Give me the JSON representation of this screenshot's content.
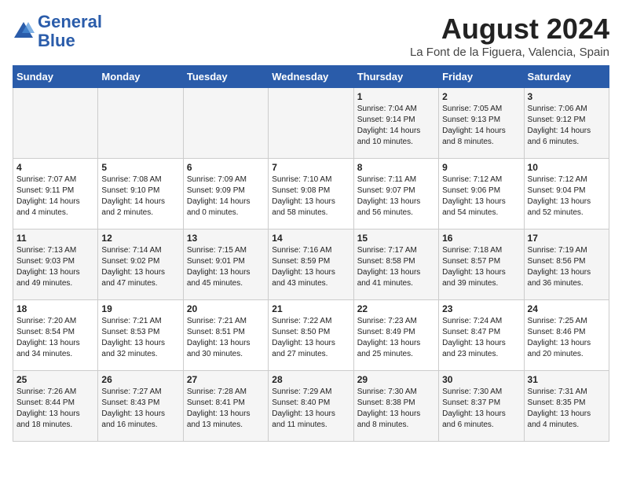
{
  "header": {
    "logo_line1": "General",
    "logo_line2": "Blue",
    "title": "August 2024",
    "subtitle": "La Font de la Figuera, Valencia, Spain"
  },
  "weekdays": [
    "Sunday",
    "Monday",
    "Tuesday",
    "Wednesday",
    "Thursday",
    "Friday",
    "Saturday"
  ],
  "weeks": [
    [
      {
        "day": "",
        "info": ""
      },
      {
        "day": "",
        "info": ""
      },
      {
        "day": "",
        "info": ""
      },
      {
        "day": "",
        "info": ""
      },
      {
        "day": "1",
        "info": "Sunrise: 7:04 AM\nSunset: 9:14 PM\nDaylight: 14 hours\nand 10 minutes."
      },
      {
        "day": "2",
        "info": "Sunrise: 7:05 AM\nSunset: 9:13 PM\nDaylight: 14 hours\nand 8 minutes."
      },
      {
        "day": "3",
        "info": "Sunrise: 7:06 AM\nSunset: 9:12 PM\nDaylight: 14 hours\nand 6 minutes."
      }
    ],
    [
      {
        "day": "4",
        "info": "Sunrise: 7:07 AM\nSunset: 9:11 PM\nDaylight: 14 hours\nand 4 minutes."
      },
      {
        "day": "5",
        "info": "Sunrise: 7:08 AM\nSunset: 9:10 PM\nDaylight: 14 hours\nand 2 minutes."
      },
      {
        "day": "6",
        "info": "Sunrise: 7:09 AM\nSunset: 9:09 PM\nDaylight: 14 hours\nand 0 minutes."
      },
      {
        "day": "7",
        "info": "Sunrise: 7:10 AM\nSunset: 9:08 PM\nDaylight: 13 hours\nand 58 minutes."
      },
      {
        "day": "8",
        "info": "Sunrise: 7:11 AM\nSunset: 9:07 PM\nDaylight: 13 hours\nand 56 minutes."
      },
      {
        "day": "9",
        "info": "Sunrise: 7:12 AM\nSunset: 9:06 PM\nDaylight: 13 hours\nand 54 minutes."
      },
      {
        "day": "10",
        "info": "Sunrise: 7:12 AM\nSunset: 9:04 PM\nDaylight: 13 hours\nand 52 minutes."
      }
    ],
    [
      {
        "day": "11",
        "info": "Sunrise: 7:13 AM\nSunset: 9:03 PM\nDaylight: 13 hours\nand 49 minutes."
      },
      {
        "day": "12",
        "info": "Sunrise: 7:14 AM\nSunset: 9:02 PM\nDaylight: 13 hours\nand 47 minutes."
      },
      {
        "day": "13",
        "info": "Sunrise: 7:15 AM\nSunset: 9:01 PM\nDaylight: 13 hours\nand 45 minutes."
      },
      {
        "day": "14",
        "info": "Sunrise: 7:16 AM\nSunset: 8:59 PM\nDaylight: 13 hours\nand 43 minutes."
      },
      {
        "day": "15",
        "info": "Sunrise: 7:17 AM\nSunset: 8:58 PM\nDaylight: 13 hours\nand 41 minutes."
      },
      {
        "day": "16",
        "info": "Sunrise: 7:18 AM\nSunset: 8:57 PM\nDaylight: 13 hours\nand 39 minutes."
      },
      {
        "day": "17",
        "info": "Sunrise: 7:19 AM\nSunset: 8:56 PM\nDaylight: 13 hours\nand 36 minutes."
      }
    ],
    [
      {
        "day": "18",
        "info": "Sunrise: 7:20 AM\nSunset: 8:54 PM\nDaylight: 13 hours\nand 34 minutes."
      },
      {
        "day": "19",
        "info": "Sunrise: 7:21 AM\nSunset: 8:53 PM\nDaylight: 13 hours\nand 32 minutes."
      },
      {
        "day": "20",
        "info": "Sunrise: 7:21 AM\nSunset: 8:51 PM\nDaylight: 13 hours\nand 30 minutes."
      },
      {
        "day": "21",
        "info": "Sunrise: 7:22 AM\nSunset: 8:50 PM\nDaylight: 13 hours\nand 27 minutes."
      },
      {
        "day": "22",
        "info": "Sunrise: 7:23 AM\nSunset: 8:49 PM\nDaylight: 13 hours\nand 25 minutes."
      },
      {
        "day": "23",
        "info": "Sunrise: 7:24 AM\nSunset: 8:47 PM\nDaylight: 13 hours\nand 23 minutes."
      },
      {
        "day": "24",
        "info": "Sunrise: 7:25 AM\nSunset: 8:46 PM\nDaylight: 13 hours\nand 20 minutes."
      }
    ],
    [
      {
        "day": "25",
        "info": "Sunrise: 7:26 AM\nSunset: 8:44 PM\nDaylight: 13 hours\nand 18 minutes."
      },
      {
        "day": "26",
        "info": "Sunrise: 7:27 AM\nSunset: 8:43 PM\nDaylight: 13 hours\nand 16 minutes."
      },
      {
        "day": "27",
        "info": "Sunrise: 7:28 AM\nSunset: 8:41 PM\nDaylight: 13 hours\nand 13 minutes."
      },
      {
        "day": "28",
        "info": "Sunrise: 7:29 AM\nSunset: 8:40 PM\nDaylight: 13 hours\nand 11 minutes."
      },
      {
        "day": "29",
        "info": "Sunrise: 7:30 AM\nSunset: 8:38 PM\nDaylight: 13 hours\nand 8 minutes."
      },
      {
        "day": "30",
        "info": "Sunrise: 7:30 AM\nSunset: 8:37 PM\nDaylight: 13 hours\nand 6 minutes."
      },
      {
        "day": "31",
        "info": "Sunrise: 7:31 AM\nSunset: 8:35 PM\nDaylight: 13 hours\nand 4 minutes."
      }
    ]
  ]
}
